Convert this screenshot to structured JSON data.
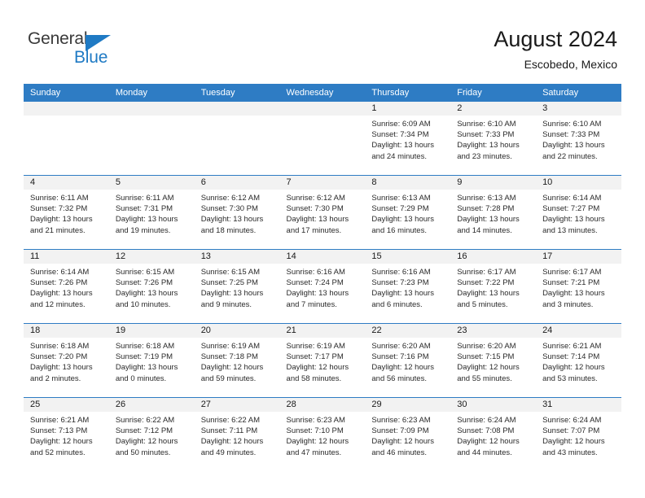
{
  "brand": {
    "name_part1": "General",
    "name_part2": "Blue",
    "triangle_color": "#1f7ac4"
  },
  "header": {
    "title": "August 2024",
    "subtitle": "Escobedo, Mexico"
  },
  "theme": {
    "header_blue": "#2e7cc4",
    "daynum_band": "#f2f2f2",
    "text": "#1a1a1a"
  },
  "weekdays": [
    "Sunday",
    "Monday",
    "Tuesday",
    "Wednesday",
    "Thursday",
    "Friday",
    "Saturday"
  ],
  "weeks": [
    [
      {
        "day": "",
        "empty": true
      },
      {
        "day": "",
        "empty": true
      },
      {
        "day": "",
        "empty": true
      },
      {
        "day": "",
        "empty": true
      },
      {
        "day": "1",
        "sunrise": "Sunrise: 6:09 AM",
        "sunset": "Sunset: 7:34 PM",
        "daylight1": "Daylight: 13 hours",
        "daylight2": "and 24 minutes."
      },
      {
        "day": "2",
        "sunrise": "Sunrise: 6:10 AM",
        "sunset": "Sunset: 7:33 PM",
        "daylight1": "Daylight: 13 hours",
        "daylight2": "and 23 minutes."
      },
      {
        "day": "3",
        "sunrise": "Sunrise: 6:10 AM",
        "sunset": "Sunset: 7:33 PM",
        "daylight1": "Daylight: 13 hours",
        "daylight2": "and 22 minutes."
      }
    ],
    [
      {
        "day": "4",
        "sunrise": "Sunrise: 6:11 AM",
        "sunset": "Sunset: 7:32 PM",
        "daylight1": "Daylight: 13 hours",
        "daylight2": "and 21 minutes."
      },
      {
        "day": "5",
        "sunrise": "Sunrise: 6:11 AM",
        "sunset": "Sunset: 7:31 PM",
        "daylight1": "Daylight: 13 hours",
        "daylight2": "and 19 minutes."
      },
      {
        "day": "6",
        "sunrise": "Sunrise: 6:12 AM",
        "sunset": "Sunset: 7:30 PM",
        "daylight1": "Daylight: 13 hours",
        "daylight2": "and 18 minutes."
      },
      {
        "day": "7",
        "sunrise": "Sunrise: 6:12 AM",
        "sunset": "Sunset: 7:30 PM",
        "daylight1": "Daylight: 13 hours",
        "daylight2": "and 17 minutes."
      },
      {
        "day": "8",
        "sunrise": "Sunrise: 6:13 AM",
        "sunset": "Sunset: 7:29 PM",
        "daylight1": "Daylight: 13 hours",
        "daylight2": "and 16 minutes."
      },
      {
        "day": "9",
        "sunrise": "Sunrise: 6:13 AM",
        "sunset": "Sunset: 7:28 PM",
        "daylight1": "Daylight: 13 hours",
        "daylight2": "and 14 minutes."
      },
      {
        "day": "10",
        "sunrise": "Sunrise: 6:14 AM",
        "sunset": "Sunset: 7:27 PM",
        "daylight1": "Daylight: 13 hours",
        "daylight2": "and 13 minutes."
      }
    ],
    [
      {
        "day": "11",
        "sunrise": "Sunrise: 6:14 AM",
        "sunset": "Sunset: 7:26 PM",
        "daylight1": "Daylight: 13 hours",
        "daylight2": "and 12 minutes."
      },
      {
        "day": "12",
        "sunrise": "Sunrise: 6:15 AM",
        "sunset": "Sunset: 7:26 PM",
        "daylight1": "Daylight: 13 hours",
        "daylight2": "and 10 minutes."
      },
      {
        "day": "13",
        "sunrise": "Sunrise: 6:15 AM",
        "sunset": "Sunset: 7:25 PM",
        "daylight1": "Daylight: 13 hours",
        "daylight2": "and 9 minutes."
      },
      {
        "day": "14",
        "sunrise": "Sunrise: 6:16 AM",
        "sunset": "Sunset: 7:24 PM",
        "daylight1": "Daylight: 13 hours",
        "daylight2": "and 7 minutes."
      },
      {
        "day": "15",
        "sunrise": "Sunrise: 6:16 AM",
        "sunset": "Sunset: 7:23 PM",
        "daylight1": "Daylight: 13 hours",
        "daylight2": "and 6 minutes."
      },
      {
        "day": "16",
        "sunrise": "Sunrise: 6:17 AM",
        "sunset": "Sunset: 7:22 PM",
        "daylight1": "Daylight: 13 hours",
        "daylight2": "and 5 minutes."
      },
      {
        "day": "17",
        "sunrise": "Sunrise: 6:17 AM",
        "sunset": "Sunset: 7:21 PM",
        "daylight1": "Daylight: 13 hours",
        "daylight2": "and 3 minutes."
      }
    ],
    [
      {
        "day": "18",
        "sunrise": "Sunrise: 6:18 AM",
        "sunset": "Sunset: 7:20 PM",
        "daylight1": "Daylight: 13 hours",
        "daylight2": "and 2 minutes."
      },
      {
        "day": "19",
        "sunrise": "Sunrise: 6:18 AM",
        "sunset": "Sunset: 7:19 PM",
        "daylight1": "Daylight: 13 hours",
        "daylight2": "and 0 minutes."
      },
      {
        "day": "20",
        "sunrise": "Sunrise: 6:19 AM",
        "sunset": "Sunset: 7:18 PM",
        "daylight1": "Daylight: 12 hours",
        "daylight2": "and 59 minutes."
      },
      {
        "day": "21",
        "sunrise": "Sunrise: 6:19 AM",
        "sunset": "Sunset: 7:17 PM",
        "daylight1": "Daylight: 12 hours",
        "daylight2": "and 58 minutes."
      },
      {
        "day": "22",
        "sunrise": "Sunrise: 6:20 AM",
        "sunset": "Sunset: 7:16 PM",
        "daylight1": "Daylight: 12 hours",
        "daylight2": "and 56 minutes."
      },
      {
        "day": "23",
        "sunrise": "Sunrise: 6:20 AM",
        "sunset": "Sunset: 7:15 PM",
        "daylight1": "Daylight: 12 hours",
        "daylight2": "and 55 minutes."
      },
      {
        "day": "24",
        "sunrise": "Sunrise: 6:21 AM",
        "sunset": "Sunset: 7:14 PM",
        "daylight1": "Daylight: 12 hours",
        "daylight2": "and 53 minutes."
      }
    ],
    [
      {
        "day": "25",
        "sunrise": "Sunrise: 6:21 AM",
        "sunset": "Sunset: 7:13 PM",
        "daylight1": "Daylight: 12 hours",
        "daylight2": "and 52 minutes."
      },
      {
        "day": "26",
        "sunrise": "Sunrise: 6:22 AM",
        "sunset": "Sunset: 7:12 PM",
        "daylight1": "Daylight: 12 hours",
        "daylight2": "and 50 minutes."
      },
      {
        "day": "27",
        "sunrise": "Sunrise: 6:22 AM",
        "sunset": "Sunset: 7:11 PM",
        "daylight1": "Daylight: 12 hours",
        "daylight2": "and 49 minutes."
      },
      {
        "day": "28",
        "sunrise": "Sunrise: 6:23 AM",
        "sunset": "Sunset: 7:10 PM",
        "daylight1": "Daylight: 12 hours",
        "daylight2": "and 47 minutes."
      },
      {
        "day": "29",
        "sunrise": "Sunrise: 6:23 AM",
        "sunset": "Sunset: 7:09 PM",
        "daylight1": "Daylight: 12 hours",
        "daylight2": "and 46 minutes."
      },
      {
        "day": "30",
        "sunrise": "Sunrise: 6:24 AM",
        "sunset": "Sunset: 7:08 PM",
        "daylight1": "Daylight: 12 hours",
        "daylight2": "and 44 minutes."
      },
      {
        "day": "31",
        "sunrise": "Sunrise: 6:24 AM",
        "sunset": "Sunset: 7:07 PM",
        "daylight1": "Daylight: 12 hours",
        "daylight2": "and 43 minutes."
      }
    ]
  ]
}
